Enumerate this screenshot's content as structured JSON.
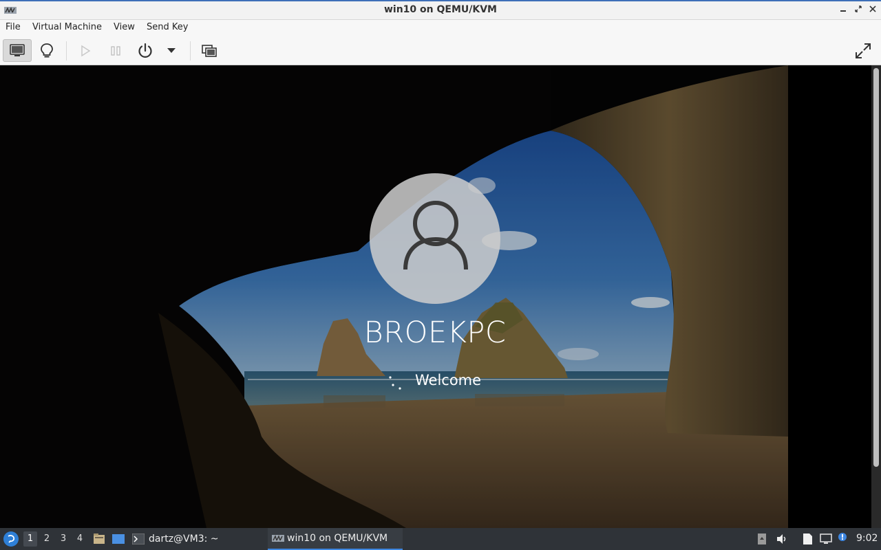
{
  "window": {
    "title": "win10 on QEMU/KVM",
    "controls": [
      "minimize-icon",
      "restore-icon",
      "close-icon"
    ]
  },
  "menubar": {
    "items": [
      "File",
      "Virtual Machine",
      "View",
      "Send Key"
    ]
  },
  "toolbar": {
    "buttons": [
      {
        "name": "console-view-button",
        "icon": "monitor-icon",
        "active": true
      },
      {
        "name": "details-view-button",
        "icon": "lightbulb-icon",
        "active": false
      },
      {
        "name": "run-button",
        "icon": "play-icon",
        "enabled": false
      },
      {
        "name": "pause-button",
        "icon": "pause-icon",
        "enabled": false
      },
      {
        "name": "shutdown-button",
        "icon": "power-icon",
        "enabled": true
      },
      {
        "name": "shutdown-menu-button",
        "icon": "chevron-down-icon",
        "enabled": true
      },
      {
        "name": "snapshots-button",
        "icon": "snapshots-icon",
        "enabled": true
      },
      {
        "name": "fullscreen-button",
        "icon": "fullscreen-icon",
        "enabled": true
      }
    ]
  },
  "guest": {
    "username": "BROEKPC",
    "status": "Welcome"
  },
  "taskbar": {
    "workspaces": [
      "1",
      "2",
      "3",
      "4"
    ],
    "active_workspace": "1",
    "tasks": [
      {
        "label": "dartz@VM3: ~",
        "icon": "terminal-icon",
        "active": false
      },
      {
        "label": "win10 on QEMU/KVM",
        "icon": "virt-manager-icon",
        "active": true
      }
    ],
    "clock": "9:02"
  },
  "colors": {
    "accent": "#3d86e0",
    "taskbar_bg": "#2f3338",
    "titlebar_border": "#3d6fb8"
  }
}
